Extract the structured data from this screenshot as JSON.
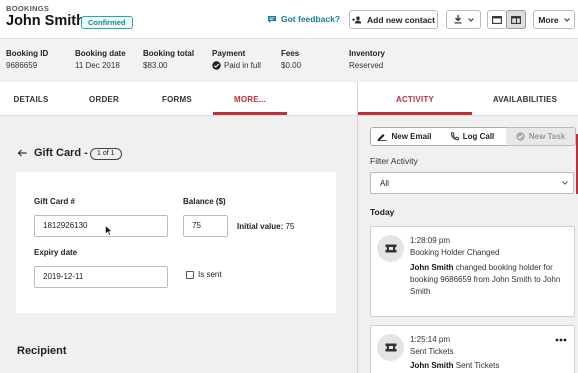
{
  "header": {
    "breadcrumb": "BOOKINGS",
    "title": "John Smith",
    "status_badge": "Confirmed",
    "feedback_link": "Got feedback?",
    "add_contact_label": "Add new contact",
    "more_label": "More"
  },
  "summary": {
    "booking_id": {
      "label": "Booking ID",
      "value": "9686659"
    },
    "booking_date": {
      "label": "Booking date",
      "value": "11 Dec 2018"
    },
    "booking_total": {
      "label": "Booking total",
      "value": "$83.00"
    },
    "payment": {
      "label": "Payment",
      "value": "Paid in full"
    },
    "fees": {
      "label": "Fees",
      "value": "$0.00"
    },
    "inventory": {
      "label": "Inventory",
      "value": "Reserved"
    }
  },
  "left_tabs": [
    {
      "label": "DETAILS",
      "active": false
    },
    {
      "label": "ORDER",
      "active": false
    },
    {
      "label": "FORMS",
      "active": false
    },
    {
      "label": "MORE...",
      "active": true
    }
  ],
  "right_tabs": [
    {
      "label": "ACTIVITY",
      "active": true
    },
    {
      "label": "AVAILABILITIES",
      "active": false
    }
  ],
  "gift_card": {
    "title": "Gift Card -",
    "pager": "1 of 1",
    "number_label": "Gift Card #",
    "number_value": "1812926130",
    "balance_label": "Balance ($)",
    "balance_value": "75",
    "initial_label": "Initial value:",
    "initial_value": "75",
    "expiry_label": "Expiry date",
    "expiry_value": "2019-12-11",
    "is_sent_label": "Is sent",
    "is_sent_checked": false
  },
  "recipient_heading": "Recipient",
  "activity": {
    "new_email_label": "New Email",
    "log_call_label": "Log Call",
    "new_task_label": "New Task",
    "filter_label": "Filter Activity",
    "filter_value": "All",
    "day_heading": "Today",
    "items": [
      {
        "time": "1:28:09 pm",
        "type": "Booking Holder Changed",
        "actor": "John Smith",
        "text": "changed booking holder for booking 9686659 from John Smith to John Smith"
      },
      {
        "time": "1:25:14 pm",
        "type": "Sent Tickets",
        "actor": "John Smith",
        "text": "Sent Tickets"
      }
    ]
  },
  "colors": {
    "accent": "#c0303a",
    "teal_badge": "#1a8a8a",
    "link": "#147a9e",
    "panel_bg": "#f0f0f0"
  }
}
